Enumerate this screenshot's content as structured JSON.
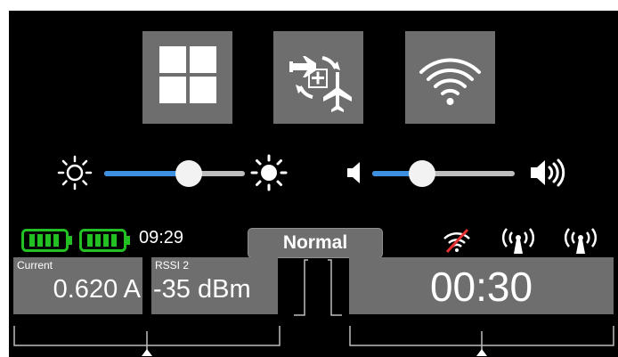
{
  "quick_buttons": [
    {
      "name": "apps",
      "icon": "apps-grid-icon"
    },
    {
      "name": "model-select",
      "icon": "model-swap-icon"
    },
    {
      "name": "wireless",
      "icon": "wifi-icon"
    }
  ],
  "brightness": {
    "level": 0.6,
    "icons": [
      "brightness-low-icon",
      "brightness-high-icon"
    ]
  },
  "volume": {
    "level": 0.35,
    "icons": [
      "volume-low-icon",
      "volume-high-icon"
    ]
  },
  "status": {
    "time": "09:29",
    "mode": "Normal",
    "batteries": [
      "battery-icon",
      "battery-icon"
    ],
    "signal_icons": [
      "wifi-off-icon",
      "antenna-icon",
      "antenna-icon"
    ]
  },
  "tiles": {
    "current": {
      "label": "Current",
      "value": "0.620 A"
    },
    "rssi": {
      "label": "RSSI 2",
      "value": "-35 dBm"
    },
    "timer": {
      "value": "00:30"
    }
  },
  "colors": {
    "background": "#000000",
    "panel": "#6e6e6e",
    "accent": "#3d8fe0",
    "battery": "#22c022"
  }
}
